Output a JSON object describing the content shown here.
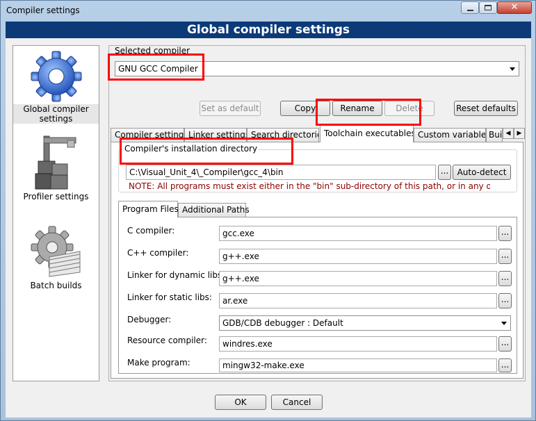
{
  "window": {
    "title": "Compiler settings"
  },
  "banner": {
    "title": "Global compiler settings"
  },
  "nav": {
    "items": [
      {
        "label_line1": "Global compiler",
        "label_line2": "settings"
      },
      {
        "label": "Profiler settings"
      },
      {
        "label": "Batch builds"
      }
    ]
  },
  "selected_compiler": {
    "label": "Selected compiler",
    "value": "GNU GCC Compiler"
  },
  "buttons": {
    "set_default": "Set as default",
    "copy": "Copy",
    "rename": "Rename",
    "delete": "Delete",
    "reset_defaults": "Reset defaults",
    "auto_detect": "Auto-detect",
    "dots": "...",
    "ok": "OK",
    "cancel": "Cancel"
  },
  "tabs": [
    {
      "label": "Compiler settings"
    },
    {
      "label": "Linker settings"
    },
    {
      "label": "Search directories"
    },
    {
      "label": "Toolchain executables"
    },
    {
      "label": "Custom variables"
    },
    {
      "label": "Build options"
    }
  ],
  "install_dir": {
    "legend": "Compiler's installation directory",
    "value": "C:\\Visual_Unit_4\\_Compiler\\gcc_4\\bin",
    "note": "NOTE: All programs must exist either in the \"bin\" sub-directory of this path, or in any of the"
  },
  "subtabs": [
    {
      "label": "Program Files"
    },
    {
      "label": "Additional Paths"
    }
  ],
  "programs": {
    "c_compiler": {
      "label": "C compiler:",
      "value": "gcc.exe"
    },
    "cpp_compiler": {
      "label": "C++ compiler:",
      "value": "g++.exe"
    },
    "linker_dynamic": {
      "label": "Linker for dynamic libs:",
      "value": "g++.exe"
    },
    "linker_static": {
      "label": "Linker for static libs:",
      "value": "ar.exe"
    },
    "debugger": {
      "label": "Debugger:",
      "value": "GDB/CDB debugger : Default"
    },
    "resource_compiler": {
      "label": "Resource compiler:",
      "value": "windres.exe"
    },
    "make_program": {
      "label": "Make program:",
      "value": "mingw32-make.exe"
    }
  },
  "colors": {
    "banner": "#0c3a78",
    "highlight_box": "#ff0000",
    "note_text": "#8b0000"
  }
}
